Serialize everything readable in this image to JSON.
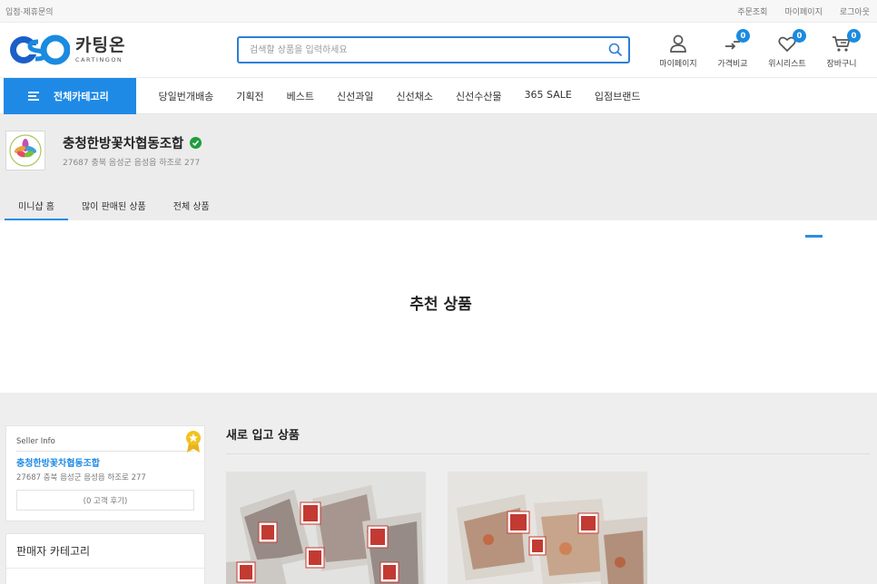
{
  "topbar": {
    "left": "입점·제휴문의",
    "links": [
      "주문조회",
      "마이페이지",
      "로그아웃"
    ]
  },
  "logo": {
    "kr": "카팅온",
    "en": "CARTINGON"
  },
  "search": {
    "placeholder": "검색할 상품을 입력하세요"
  },
  "header_icons": [
    {
      "label": "마이페이지",
      "icon": "user-icon",
      "badge": null
    },
    {
      "label": "가격비교",
      "icon": "compare-icon",
      "badge": "0"
    },
    {
      "label": "위시리스트",
      "icon": "heart-icon",
      "badge": "0"
    },
    {
      "label": "장바구니",
      "icon": "cart-icon",
      "badge": "0"
    }
  ],
  "nav": {
    "category_button": "전체카테고리",
    "items": [
      "당일번개배송",
      "기획전",
      "베스트",
      "신선과일",
      "신선채소",
      "신선수산물",
      "365 SALE",
      "입점브랜드"
    ]
  },
  "shop": {
    "name": "충청한방꽃차협동조합",
    "address": "27687 충북 음성군 음성읍 하조로 277",
    "tabs": [
      "미니샵 홈",
      "많이 판매된 상품",
      "전체 상품"
    ]
  },
  "recommended": {
    "title": "추천 상품"
  },
  "seller_info": {
    "caption": "Seller Info",
    "name": "충청한방꽃차협동조합",
    "address": "27687 충북 음성군 음성읍 하조로 277",
    "reviews": "(0 고객 후기)"
  },
  "seller_category": {
    "title": "판매자 카테고리"
  },
  "new_arrivals": {
    "title": "새로 입고 상품"
  },
  "colors": {
    "accent": "#1f8ae6",
    "verified": "#1e9e3c",
    "badge": "#1a8be0"
  }
}
